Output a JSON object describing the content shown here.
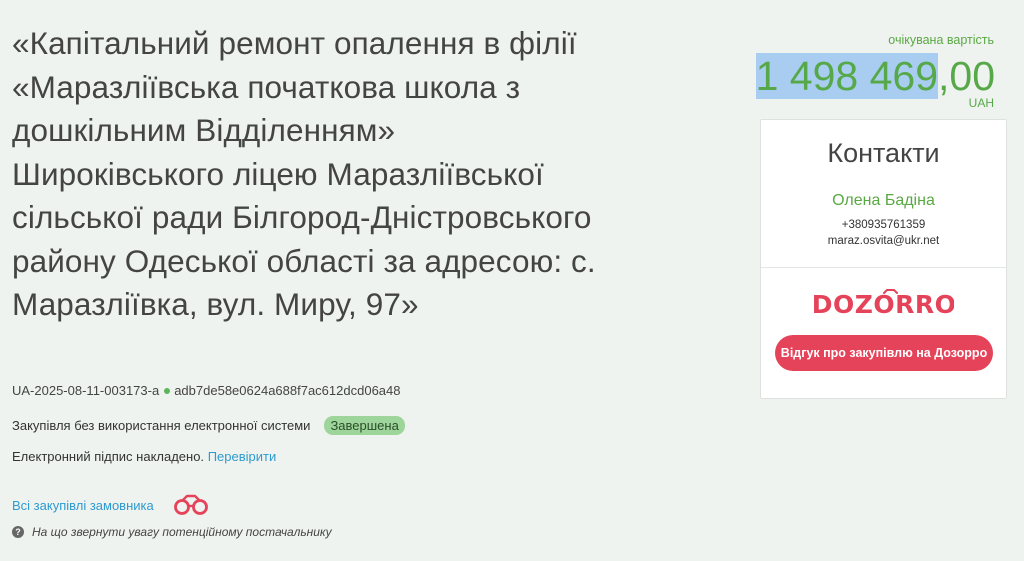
{
  "tender": {
    "title": "«Капітальний ремонт опалення в філії «Маразліївська початкова школа з дошкільним Відділенням» Широківського ліцею Маразліївської сільської ради Білгород-Дністровського району Одеської області за адресою: с. Маразліївка, вул. Миру, 97»",
    "id": "UA-2025-08-11-003173-a",
    "hash": "adb7de58e0624a688f7ac612dcd06a48",
    "procurement_type": "Закупівля без використання електронної системи",
    "status": "Завершена",
    "signature_text": "Електронний підпис накладено.",
    "verify_link": "Перевірити",
    "all_purchases_link": "Всі закупівлі замовника",
    "hint_text": "На що звернути увагу потенційному постачальнику"
  },
  "price": {
    "label": "очікувана вартість",
    "integer_part": "1 498 469",
    "decimal_part": ",00",
    "currency": "UAH"
  },
  "contacts": {
    "title": "Контакти",
    "name": "Олена Бадіна",
    "phone": "+380935761359",
    "email": "maraz.osvita@ukr.net",
    "dozorro_logo_text": "DOZORRO",
    "dozorro_button": "Відгук про закупівлю на Дозорро"
  },
  "colors": {
    "accent_green": "#57a848",
    "link_blue": "#2e9ad0",
    "dozorro_red": "#e5435a",
    "status_badge_bg": "#9ed59a",
    "selection_highlight": "#a8cdf0"
  },
  "icons": {
    "id_separator": "green-dot-icon",
    "all_purchases": "binoculars-icon",
    "hint": "question-circle-icon"
  }
}
